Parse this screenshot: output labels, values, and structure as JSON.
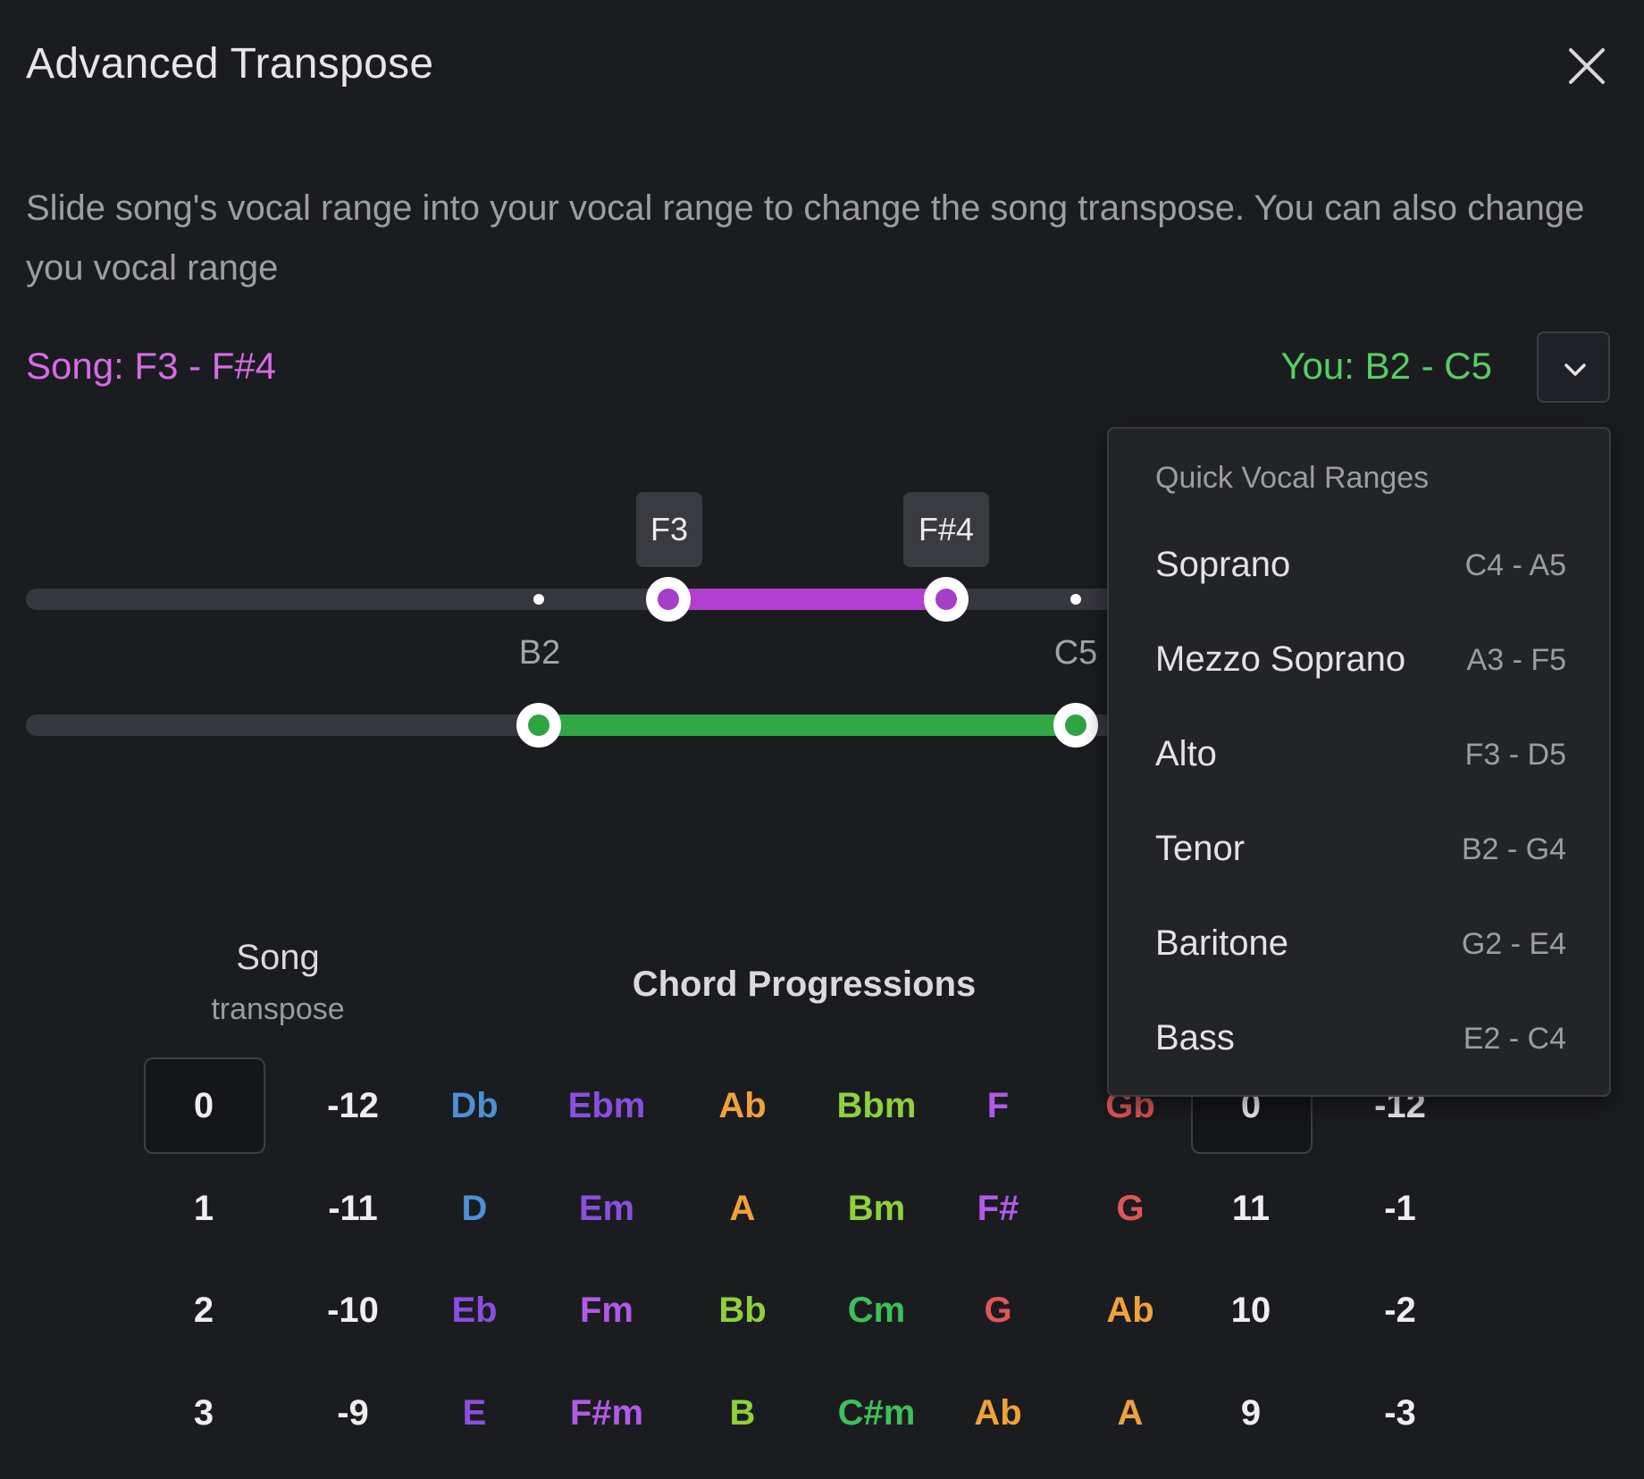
{
  "dialog": {
    "title": "Advanced Transpose",
    "description": "Slide song's vocal range into your vocal range to change the song transpose. You can also change you vocal range"
  },
  "ranges": {
    "song_label": "Song: F3 - F#4",
    "you_label": "You: B2 - C5",
    "song_color": "#d76be6",
    "you_color": "#55cf62"
  },
  "sliders": {
    "song": {
      "low": "F3",
      "high": "F#4"
    },
    "you": {
      "low": "B2",
      "high": "C5"
    }
  },
  "table": {
    "song_header": "Song",
    "song_subheader": "transpose",
    "chords_header": "Chord Progressions",
    "rows": [
      {
        "transpose": "0",
        "offset": "-12",
        "chords": [
          "Db",
          "Ebm",
          "Ab",
          "Bbm",
          "F",
          "Gb"
        ],
        "right_a": "0",
        "right_b": "-12"
      },
      {
        "transpose": "1",
        "offset": "-11",
        "chords": [
          "D",
          "Em",
          "A",
          "Bm",
          "F#",
          "G"
        ],
        "right_a": "11",
        "right_b": "-1"
      },
      {
        "transpose": "2",
        "offset": "-10",
        "chords": [
          "Eb",
          "Fm",
          "Bb",
          "Cm",
          "G",
          "Ab"
        ],
        "right_a": "10",
        "right_b": "-2"
      },
      {
        "transpose": "3",
        "offset": "-9",
        "chords": [
          "E",
          "F#m",
          "B",
          "C#m",
          "Ab",
          "A"
        ],
        "right_a": "9",
        "right_b": "-3"
      }
    ],
    "chord_colors": [
      [
        "#4f8fd6",
        "#8a4fe0",
        "#f0a23a",
        "#8ed13c",
        "#b15ae8",
        "#e05656"
      ],
      [
        "#4f8fd6",
        "#8a4fe0",
        "#f0a23a",
        "#8ed13c",
        "#b15ae8",
        "#e05656"
      ],
      [
        "#8a4fe0",
        "#b15ae8",
        "#8ed13c",
        "#3fbf5a",
        "#e05656",
        "#f0a23a"
      ],
      [
        "#8a4fe0",
        "#b15ae8",
        "#8ed13c",
        "#3fbf5a",
        "#f0a23a",
        "#f0a23a"
      ]
    ]
  },
  "quick_ranges": {
    "header": "Quick Vocal Ranges",
    "items": [
      {
        "name": "Soprano",
        "range": "C4 - A5"
      },
      {
        "name": "Mezzo Soprano",
        "range": "A3 - F5"
      },
      {
        "name": "Alto",
        "range": "F3 - D5"
      },
      {
        "name": "Tenor",
        "range": "B2 - G4"
      },
      {
        "name": "Baritone",
        "range": "G2 - E4"
      },
      {
        "name": "Bass",
        "range": "E2 - C4"
      }
    ]
  },
  "icons": {
    "close": "close-icon",
    "dropdown": "chevron-down-icon"
  }
}
